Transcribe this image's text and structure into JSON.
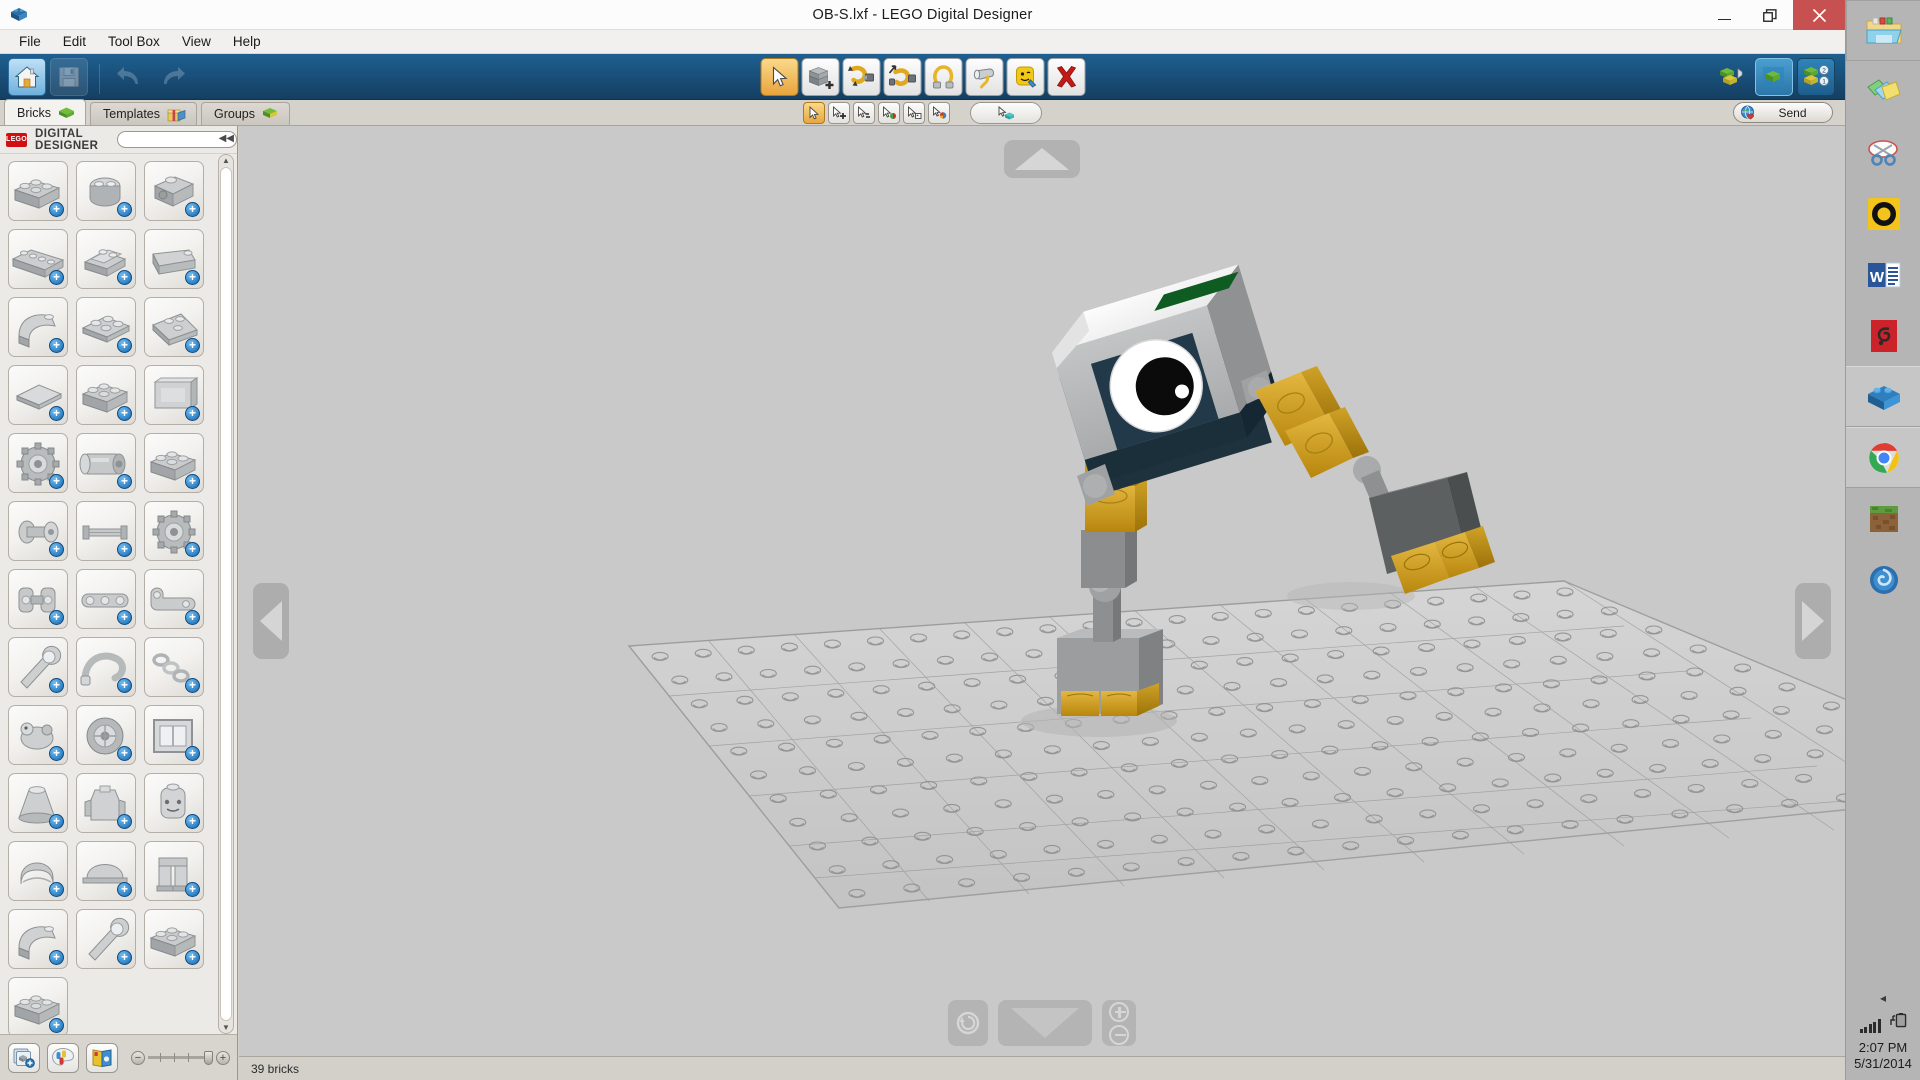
{
  "window": {
    "title": "OB-S.lxf - LEGO Digital Designer",
    "app_icon": "lego-brick-icon",
    "controls": {
      "minimize": "minimize-icon",
      "restore": "restore-icon",
      "close": "close-icon"
    }
  },
  "menubar": {
    "items": [
      {
        "label": "File"
      },
      {
        "label": "Edit"
      },
      {
        "label": "Tool Box"
      },
      {
        "label": "View"
      },
      {
        "label": "Help"
      }
    ]
  },
  "main_toolbar": {
    "left": [
      {
        "name": "home-button",
        "icon": "home-icon",
        "state": "active"
      },
      {
        "name": "save-button",
        "icon": "floppy-disk-icon",
        "state": "disabled"
      },
      {
        "name": "undo-button",
        "icon": "undo-arrow-icon",
        "state": "disabled"
      },
      {
        "name": "redo-button",
        "icon": "redo-arrow-icon",
        "state": "disabled"
      }
    ],
    "center": [
      {
        "name": "select-tool",
        "icon": "cursor-arrow-icon",
        "state": "active"
      },
      {
        "name": "clone-tool",
        "icon": "clone-brick-icon",
        "state": "normal"
      },
      {
        "name": "hinge-tool",
        "icon": "hinge-rotate-icon",
        "state": "normal"
      },
      {
        "name": "flex-tool",
        "icon": "flex-hose-icon",
        "state": "normal"
      },
      {
        "name": "bend-tool",
        "icon": "flexible-tube-icon",
        "state": "normal"
      },
      {
        "name": "paint-tool",
        "icon": "paint-bucket-icon",
        "state": "normal"
      },
      {
        "name": "clone-color-tool",
        "icon": "minifig-head-icon",
        "state": "normal"
      },
      {
        "name": "delete-tool",
        "icon": "red-x-icon",
        "state": "normal"
      }
    ],
    "right": [
      {
        "name": "build-mode-button",
        "icon": "build-bricks-icon",
        "state": "normal"
      },
      {
        "name": "view-mode-button",
        "icon": "view-brick-icon",
        "state": "selected"
      },
      {
        "name": "building-guide-button",
        "icon": "guide-steps-icon",
        "state": "normal"
      }
    ]
  },
  "tabs": [
    {
      "label": "Bricks",
      "icon": "green-brick-icon",
      "active": true
    },
    {
      "label": "Templates",
      "icon": "templates-box-icon",
      "active": false
    },
    {
      "label": "Groups",
      "icon": "groups-brick-icon",
      "active": false
    }
  ],
  "sub_toolbar": {
    "buttons": [
      {
        "name": "select-single-tool",
        "icon": "cursor-icon",
        "state": "active"
      },
      {
        "name": "select-add-tool",
        "icon": "cursor-plus-icon",
        "state": "normal"
      },
      {
        "name": "select-same-shape-tool",
        "icon": "cursor-shape-icon",
        "state": "normal"
      },
      {
        "name": "select-same-color-tool",
        "icon": "cursor-color-icon",
        "state": "normal"
      },
      {
        "name": "select-connected-tool",
        "icon": "cursor-connected-icon",
        "state": "normal"
      },
      {
        "name": "select-all-tool",
        "icon": "cursor-all-icon",
        "state": "normal"
      }
    ],
    "wide_button": {
      "name": "selection-info-button",
      "icon": "cursor-cyan-brick-icon"
    },
    "send": {
      "label": "Send",
      "icon": "globe-heart-icon"
    }
  },
  "palette": {
    "brand_badge": "LEGO",
    "brand_label": "DIGITAL DESIGNER",
    "search": {
      "value": "",
      "placeholder": ""
    },
    "collapse_icon": "collapse-left-icon",
    "brick_count_rows": 13,
    "bricks": [
      {
        "name": "brick-2x4",
        "shape": "brick"
      },
      {
        "name": "brick-round-2x2",
        "shape": "round"
      },
      {
        "name": "brick-headlight-1x1",
        "shape": "headlight"
      },
      {
        "name": "brick-1x6",
        "shape": "long"
      },
      {
        "name": "slope-2x2",
        "shape": "slope"
      },
      {
        "name": "wedge-slope",
        "shape": "wedge"
      },
      {
        "name": "brick-curved-1x2",
        "shape": "curve"
      },
      {
        "name": "plate-2x2",
        "shape": "plate"
      },
      {
        "name": "wedge-plate-3x4",
        "shape": "wedgeplate"
      },
      {
        "name": "tile-2x2",
        "shape": "tile"
      },
      {
        "name": "brick-modified",
        "shape": "brick"
      },
      {
        "name": "panel-1x4",
        "shape": "panel"
      },
      {
        "name": "technic-gear",
        "shape": "gear"
      },
      {
        "name": "technic-motor",
        "shape": "motor"
      },
      {
        "name": "technic-brick",
        "shape": "brick"
      },
      {
        "name": "technic-pin",
        "shape": "pin"
      },
      {
        "name": "technic-axle",
        "shape": "axle"
      },
      {
        "name": "technic-gear-large",
        "shape": "gear"
      },
      {
        "name": "technic-connector",
        "shape": "connector"
      },
      {
        "name": "technic-beam",
        "shape": "beam"
      },
      {
        "name": "technic-liftarm",
        "shape": "liftarm"
      },
      {
        "name": "tool-wrench",
        "shape": "wrench"
      },
      {
        "name": "accessory-hose",
        "shape": "hose"
      },
      {
        "name": "accessory-chain",
        "shape": "chain"
      },
      {
        "name": "animal-part",
        "shape": "animal"
      },
      {
        "name": "wheel-hub",
        "shape": "wheel"
      },
      {
        "name": "window-frame",
        "shape": "window"
      },
      {
        "name": "megaphone-part",
        "shape": "cone"
      },
      {
        "name": "minifig-torso",
        "shape": "torso"
      },
      {
        "name": "minifig-head",
        "shape": "head"
      },
      {
        "name": "minifig-hair",
        "shape": "hair"
      },
      {
        "name": "minifig-cap",
        "shape": "cap"
      },
      {
        "name": "minifig-legs",
        "shape": "legs"
      },
      {
        "name": "accessory-small",
        "shape": "curve"
      },
      {
        "name": "tool-screwdriver",
        "shape": "wrench"
      },
      {
        "name": "brick-special",
        "shape": "brick"
      },
      {
        "name": "brick-misc",
        "shape": "brick"
      }
    ],
    "footer": [
      {
        "name": "new-palette-button",
        "icon": "stack-plus-icon"
      },
      {
        "name": "color-palette-button",
        "icon": "color-palette-icon"
      },
      {
        "name": "brick-catalog-button",
        "icon": "catalog-book-icon"
      }
    ],
    "zoom_slider": {
      "minus": "minus-icon",
      "plus": "plus-icon",
      "value": 75
    }
  },
  "viewport": {
    "nav_left": "nav-left-arrow-icon",
    "nav_right": "nav-right-arrow-icon",
    "nav_top": "nav-up-arrow-icon",
    "nav_rotate": "reset-rotation-icon",
    "nav_down": "nav-down-arrow-icon",
    "zoom_in": "zoom-in-icon",
    "zoom_out": "zoom-out-icon",
    "model": {
      "name": "lego-robot-model",
      "description": "Grey and gold LEGO robot with single large eye, two arms and one leg standing on a baseplate",
      "baseplate": "grey-baseplate"
    }
  },
  "statusbar": {
    "text": "39 bricks"
  },
  "taskbar": {
    "items": [
      {
        "name": "taskbar-file-explorer",
        "icon": "folder-icon",
        "active": false,
        "pinned_box": true
      },
      {
        "name": "taskbar-sticky-notes",
        "icon": "sticky-notes-icon",
        "active": false
      },
      {
        "name": "taskbar-snipping-tool",
        "icon": "scissors-icon",
        "active": false
      },
      {
        "name": "taskbar-orange-app",
        "icon": "yellow-ring-icon",
        "active": false
      },
      {
        "name": "taskbar-word",
        "icon": "word-icon",
        "active": false
      },
      {
        "name": "taskbar-red-app",
        "icon": "red-swirl-icon",
        "active": false
      },
      {
        "name": "taskbar-lego-digital-designer",
        "icon": "lego-brick-icon",
        "active": true
      },
      {
        "name": "taskbar-chrome",
        "icon": "chrome-icon",
        "active": true
      },
      {
        "name": "taskbar-minecraft",
        "icon": "minecraft-grass-icon",
        "active": false
      },
      {
        "name": "taskbar-blue-spiral-app",
        "icon": "blue-spiral-icon",
        "active": false
      }
    ],
    "tray": {
      "show_hidden_icon": "chevron-left-icon",
      "network_icon": "wifi-signal-icon",
      "battery_icon": "battery-charging-icon",
      "time": "2:07 PM",
      "date": "5/31/2014"
    }
  },
  "colors": {
    "toolbar_blue": "#1b5480",
    "accent_orange": "#e8a43c",
    "close_red": "#c75050",
    "viewport_grey": "#c9c9c9",
    "taskbar_grey": "#b5b5b5",
    "gold": "#c8960f",
    "robot_grey": "#9a9a9a"
  }
}
